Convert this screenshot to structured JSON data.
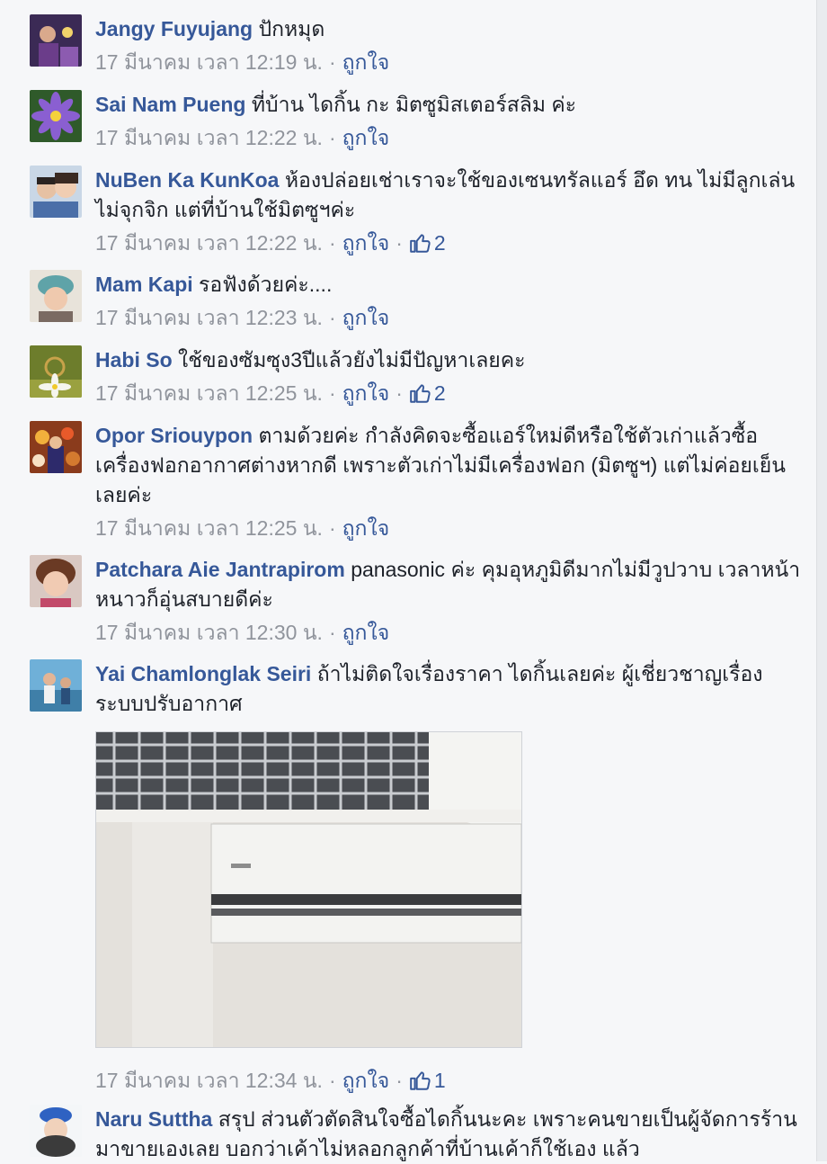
{
  "comments": [
    {
      "author": "Jangy Fuyujang",
      "text": "ปักหมุด",
      "time": "17 มีนาคม เวลา 12:19 น.",
      "like_label": "ถูกใจ",
      "sep": "·",
      "likes": ""
    },
    {
      "author": "Sai Nam Pueng",
      "text": "ที่บ้าน ไดกิ้น กะ มิตซูมิสเตอร์สลิม ค่ะ",
      "time": "17 มีนาคม เวลา 12:22 น.",
      "like_label": "ถูกใจ",
      "sep": "·",
      "likes": ""
    },
    {
      "author": "NuBen Ka KunKoa",
      "text": "ห้องปล่อยเช่าเราจะใช้ของเซนทรัลแอร์ อึด ทน ไม่มีลูกเล่น ไม่จุกจิก แต่ที่บ้านใช้มิตซูฯค่ะ",
      "time": "17 มีนาคม เวลา 12:22 น.",
      "like_label": "ถูกใจ",
      "sep": "·",
      "likes": "2"
    },
    {
      "author": "Mam Kapi",
      "text": "รอฟังด้วยค่ะ....",
      "time": "17 มีนาคม เวลา 12:23 น.",
      "like_label": "ถูกใจ",
      "sep": "·",
      "likes": ""
    },
    {
      "author": "Habi So",
      "text": "ใช้ของซัมซุง3ปีแล้วยังไม่มีปัญหาเลยคะ",
      "time": "17 มีนาคม เวลา 12:25 น.",
      "like_label": "ถูกใจ",
      "sep": "·",
      "likes": "2"
    },
    {
      "author": "Opor Sriouypon",
      "text": "ตามด้วยค่ะ กำลังคิดจะซื้อแอร์ใหม่ดีหรือใช้ตัวเก่าแล้วซื้อเครื่องฟอกอากาศต่างหากดี เพราะตัวเก่าไม่มีเครื่องฟอก (มิตซูฯ) แต่ไม่ค่อยเย็นเลยค่ะ",
      "time": "17 มีนาคม เวลา 12:25 น.",
      "like_label": "ถูกใจ",
      "sep": "·",
      "likes": ""
    },
    {
      "author": "Patchara Aie Jantrapirom",
      "text": "panasonic ค่ะ คุมอุหภูมิดีมากไม่มีวูปวาบ เวลาหน้าหนาวก็อุ่นสบายดีค่ะ",
      "time": "17 มีนาคม เวลา 12:30 น.",
      "like_label": "ถูกใจ",
      "sep": "·",
      "likes": ""
    },
    {
      "author": "Yai Chamlonglak Seiri",
      "text": "ถ้าไม่ติดใจเรื่องราคา ไดกิ้นเลยค่ะ ผู้เชี่ยวชาญเรื่องระบบปรับอากาศ",
      "time": "17 มีนาคม เวลา 12:34 น.",
      "like_label": "ถูกใจ",
      "sep": "·",
      "likes": "1"
    },
    {
      "author": "Naru Suttha",
      "text": "สรุป ส่วนตัวตัดสินใจซื้อไดกิ้นนะคะ เพราะคนขายเป็นผู้จัดการร้านมาขายเองเลย บอกว่าเค้าไม่หลอกลูกค้าที่บ้านเค้าก็ใช้เอง แล้ว",
      "time": "",
      "like_label": "",
      "sep": "",
      "likes": ""
    }
  ],
  "colors": {
    "link": "#365899",
    "meta": "#90949c",
    "background": "#f6f7f9"
  },
  "icons": {
    "like": "thumbs-up-icon"
  }
}
